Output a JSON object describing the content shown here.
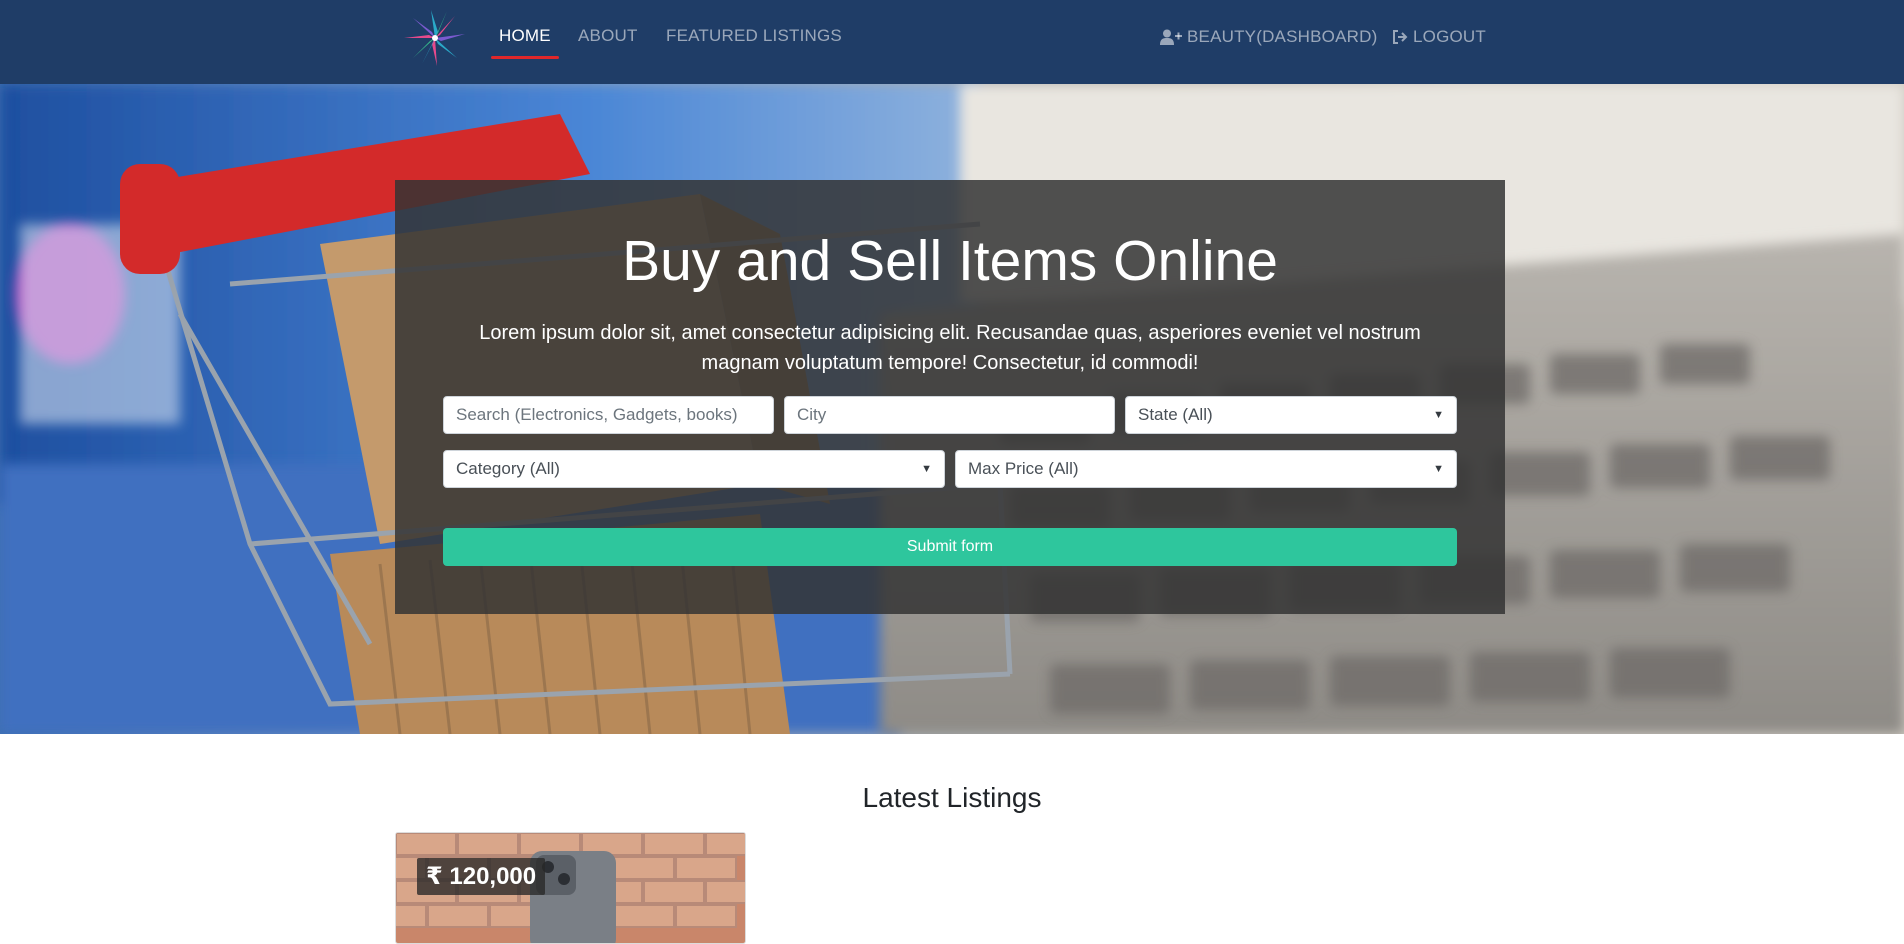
{
  "nav": {
    "logo": "starburst-logo",
    "links": [
      "HOME",
      "ABOUT",
      "FEATURED LISTINGS"
    ],
    "active": "HOME",
    "dashboard_label": "BEAUTY(DASHBOARD)",
    "logout_label": "LOGOUT",
    "accent_color": "#e0272a",
    "background_color": "#1f3d67"
  },
  "hero": {
    "title": "Buy and Sell Items Online",
    "lead": "Lorem ipsum dolor sit, amet consectetur adipisicing elit. Recusandae quas, asperiores eveniet vel nostrum magnam voluptatum tempore! Consectetur, id commodi!",
    "search_placeholder": "Search (Electronics, Gadgets, books)",
    "city_placeholder": "City",
    "state_selected": "State (All)",
    "category_selected": "Category (All)",
    "max_price_selected": "Max Price (All)",
    "submit_label": "Submit form",
    "submit_color": "#2ec69d"
  },
  "listings": {
    "title": "Latest Listings",
    "items": [
      {
        "price": "₹ 120,000",
        "image": "phone-on-brick-wall"
      }
    ]
  }
}
